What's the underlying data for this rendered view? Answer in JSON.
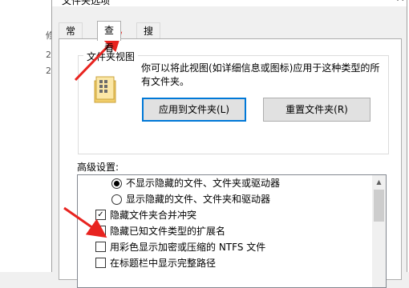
{
  "dialog": {
    "title": "文件夹选项",
    "tabs": [
      {
        "label": "常规",
        "active": false
      },
      {
        "label": "查看",
        "active": true
      },
      {
        "label": "搜索",
        "active": false
      }
    ]
  },
  "background": {
    "side_chars": [
      "修",
      "2",
      "2"
    ]
  },
  "folder_views": {
    "group_label": "文件夹视图",
    "description": "你可以将此视图(如详细信息或图标)应用于这种类型的所有文件夹。",
    "apply_button": "应用到文件夹(L)",
    "reset_button": "重置文件夹(R)"
  },
  "advanced": {
    "label": "高级设置:",
    "items": [
      {
        "type": "radio",
        "label": "不显示隐藏的文件、文件夹或驱动器",
        "checked": true
      },
      {
        "type": "radio",
        "label": "显示隐藏的文件、文件夹和驱动器",
        "checked": false
      },
      {
        "type": "checkbox",
        "label": "隐藏文件夹合并冲突",
        "checked": true
      },
      {
        "type": "checkbox",
        "label": "隐藏已知文件类型的扩展名",
        "checked": false
      },
      {
        "type": "checkbox",
        "label": "用彩色显示加密或压缩的 NTFS 文件",
        "checked": false
      },
      {
        "type": "checkbox",
        "label": "在标题栏中显示完整路径",
        "checked": false
      }
    ]
  },
  "colors": {
    "arrow": "#e8231f",
    "accent": "#0078d7"
  }
}
